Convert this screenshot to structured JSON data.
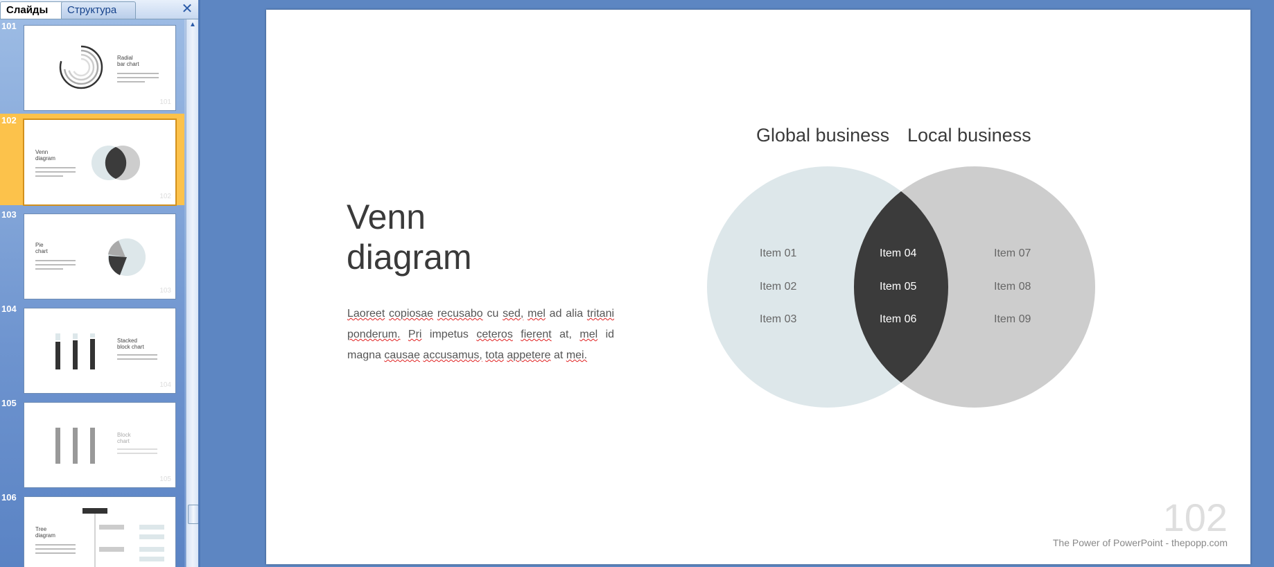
{
  "pane": {
    "tab_slides": "Слайды",
    "tab_outline": "Структура",
    "close_glyph": "✕",
    "thumbnails": [
      {
        "num": "101",
        "title": "Radial\nbar chart",
        "page": "101"
      },
      {
        "num": "102",
        "title": "Venn\ndiagram",
        "page": "102",
        "selected": true
      },
      {
        "num": "103",
        "title": "Pie\nchart",
        "page": "103"
      },
      {
        "num": "104",
        "title": "Stacked\nblock chart",
        "page": "104"
      },
      {
        "num": "105",
        "title": "Block\nchart",
        "page": "105"
      },
      {
        "num": "106",
        "title": "Tree\ndiagram",
        "page": ""
      }
    ]
  },
  "slide": {
    "title_line1": "Venn",
    "title_line2": "diagram",
    "body_words": [
      "Laoreet",
      "copiosae",
      "recusabo",
      "cu",
      "sed,",
      "mel",
      "ad",
      "alia",
      "tritani",
      "ponderum.",
      "Pri",
      "impetus",
      "ceteros",
      "fierent",
      "at,",
      "mel",
      "id",
      "magna",
      "causae",
      "accusamus,",
      "tota",
      "appetere",
      "at",
      "mei."
    ],
    "venn": {
      "left_set": "Global business",
      "right_set": "Local business",
      "left_items": [
        "Item 01",
        "Item 02",
        "Item 03"
      ],
      "overlap_items": [
        "Item 04",
        "Item 05",
        "Item 06"
      ],
      "right_items": [
        "Item 07",
        "Item 08",
        "Item 09"
      ],
      "left_color": "#dde7ea",
      "right_color": "#cdcdcd",
      "overlap_color": "#3b3b3b"
    },
    "page_number": "102",
    "footer": "The Power of PowerPoint - thepopp.com"
  }
}
